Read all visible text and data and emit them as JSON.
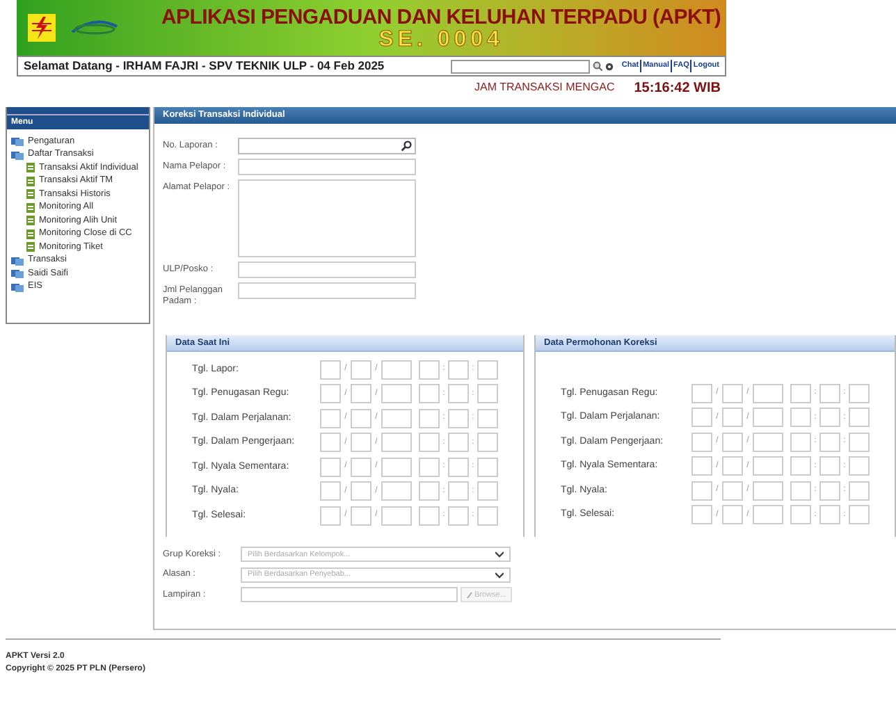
{
  "banner": {
    "title": "APLIKASI PENGADUAN DAN KELUHAN TERPADU (APKT)",
    "subtitle": "SE. 0004"
  },
  "welcome": "Selamat Datang - IRHAM FAJRI - SPV TEKNIK ULP - 04 Feb 2025",
  "top_links": [
    "Chat",
    "Manual",
    "FAQ",
    "Logout"
  ],
  "clock": {
    "label": "JAM TRANSAKSI MENGAC",
    "time": "15:16:42 WIB"
  },
  "sidebar": {
    "title": "Menu",
    "items": [
      {
        "label": "Pengaturan"
      },
      {
        "label": "Daftar Transaksi",
        "children": [
          {
            "label": "Transaksi Aktif Individual"
          },
          {
            "label": "Transaksi Aktif TM"
          },
          {
            "label": "Transaksi Historis"
          },
          {
            "label": "Monitoring All"
          },
          {
            "label": "Monitoring Alih Unit"
          },
          {
            "label": "Monitoring Close di CC"
          },
          {
            "label": "Monitoring Tiket"
          }
        ]
      },
      {
        "label": "Transaksi"
      },
      {
        "label": "Saidi Saifi"
      },
      {
        "label": "EIS"
      }
    ]
  },
  "panel": {
    "title": "Koreksi Transaksi Individual",
    "fields": [
      {
        "label": "No. Laporan :",
        "kind": "search"
      },
      {
        "label": "Nama Pelapor :",
        "kind": "text"
      },
      {
        "label": "Alamat Pelapor :",
        "kind": "textarea"
      },
      {
        "label": "ULP/Posko :",
        "kind": "text"
      },
      {
        "label": "Jml Pelanggan Padam :",
        "kind": "text"
      }
    ],
    "groups": [
      {
        "title": "Data Saat Ini",
        "rows": [
          {
            "label": "Tgl. Lapor:",
            "separators": [
              "/",
              "/",
              ":",
              ":"
            ]
          },
          {
            "label": "Tgl. Penugasan Regu:",
            "separators": [
              "/",
              "/",
              ":",
              ":"
            ]
          },
          {
            "label": "Tgl. Dalam Perjalanan:",
            "separators": [
              "/",
              "/",
              ":",
              ":"
            ]
          },
          {
            "label": "Tgl. Dalam Pengerjaan:",
            "separators": [
              "/",
              "/",
              ":",
              ":"
            ]
          },
          {
            "label": "Tgl. Nyala Sementara:",
            "separators": [
              "/",
              "/",
              ":",
              ":"
            ]
          },
          {
            "label": "Tgl. Nyala:",
            "separators": [
              "/",
              "/",
              ":",
              ":"
            ]
          },
          {
            "label": "Tgl. Selesai:",
            "separators": [
              "/",
              "/",
              ":",
              ":"
            ]
          }
        ]
      },
      {
        "title": "Data Permohonan Koreksi",
        "rows": [
          {
            "label": "Tgl. Penugasan Regu:",
            "separators": [
              "/",
              "/",
              ":",
              ":"
            ]
          },
          {
            "label": "Tgl. Dalam Perjalanan:",
            "separators": [
              "/",
              "/",
              ":",
              ":"
            ]
          },
          {
            "label": "Tgl. Dalam Pengerjaan:",
            "separators": [
              "/",
              "/",
              ":",
              ":"
            ]
          },
          {
            "label": "Tgl. Nyala Sementara:",
            "separators": [
              "/",
              "/",
              ":",
              ":"
            ]
          },
          {
            "label": "Tgl. Nyala:",
            "separators": [
              "/",
              "/",
              ":",
              ":"
            ]
          },
          {
            "label": "Tgl. Selesai:",
            "separators": [
              "/",
              "/",
              ":",
              ":"
            ]
          }
        ]
      }
    ],
    "bottom_fields": [
      {
        "label": "Grup Koreksi :",
        "kind": "select",
        "placeholder": "Pilih Berdasarkan Kelompok..."
      },
      {
        "label": "Alasan :",
        "kind": "select",
        "placeholder": "Pilih Berdasarkan Penyebab..."
      },
      {
        "label": "Lampiran :",
        "kind": "file",
        "button": "Browse..."
      }
    ]
  },
  "footer": {
    "version": "APKT Versi 2.0",
    "copyright": "Copyright © 2025 PT PLN (Persero)"
  }
}
